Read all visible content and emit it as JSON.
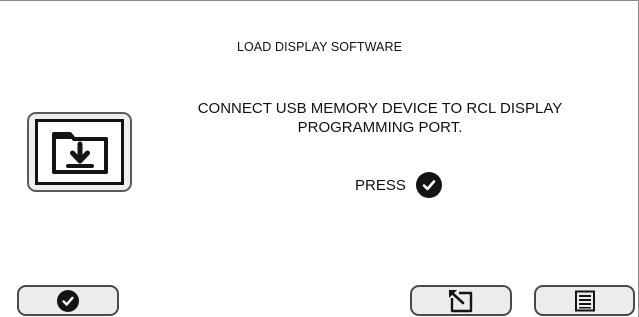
{
  "screen": {
    "title": "LOAD DISPLAY SOFTWARE",
    "message": "CONNECT USB MEMORY DEVICE TO RCL DISPLAY PROGRAMMING PORT.",
    "press_label": "PRESS",
    "press_icon": "checkmark-circle-icon"
  },
  "usb_tile": {
    "icon": "folder-download-icon"
  },
  "softkeys": [
    {
      "icon": "checkmark-circle-icon"
    },
    {
      "icon": "return-arrow-icon"
    },
    {
      "icon": "menu-list-icon"
    }
  ],
  "colors": {
    "icon": "#141414",
    "key_fill": "#ececec",
    "key_border": "#4a4a4a",
    "frame": "#8a8a8a"
  }
}
